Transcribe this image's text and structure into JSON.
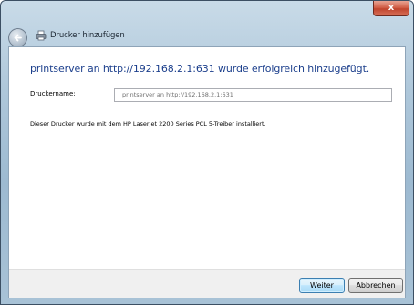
{
  "window": {
    "title": "Drucker hinzufügen",
    "close_glyph": "x"
  },
  "content": {
    "heading": "printserver an http://192.168.2.1:631 wurde erfolgreich hinzugefügt.",
    "printer_name_label": "Druckername:",
    "printer_name_value": "printserver an http://192.168.2.1:631",
    "info": "Dieser Drucker wurde mit dem HP LaserJet 2200 Series PCL 5-Treiber installiert."
  },
  "buttons": {
    "next": "Weiter",
    "cancel": "Abbrechen"
  },
  "icons": {
    "back": "back-arrow-icon",
    "title": "printer-icon",
    "close": "close-icon"
  }
}
